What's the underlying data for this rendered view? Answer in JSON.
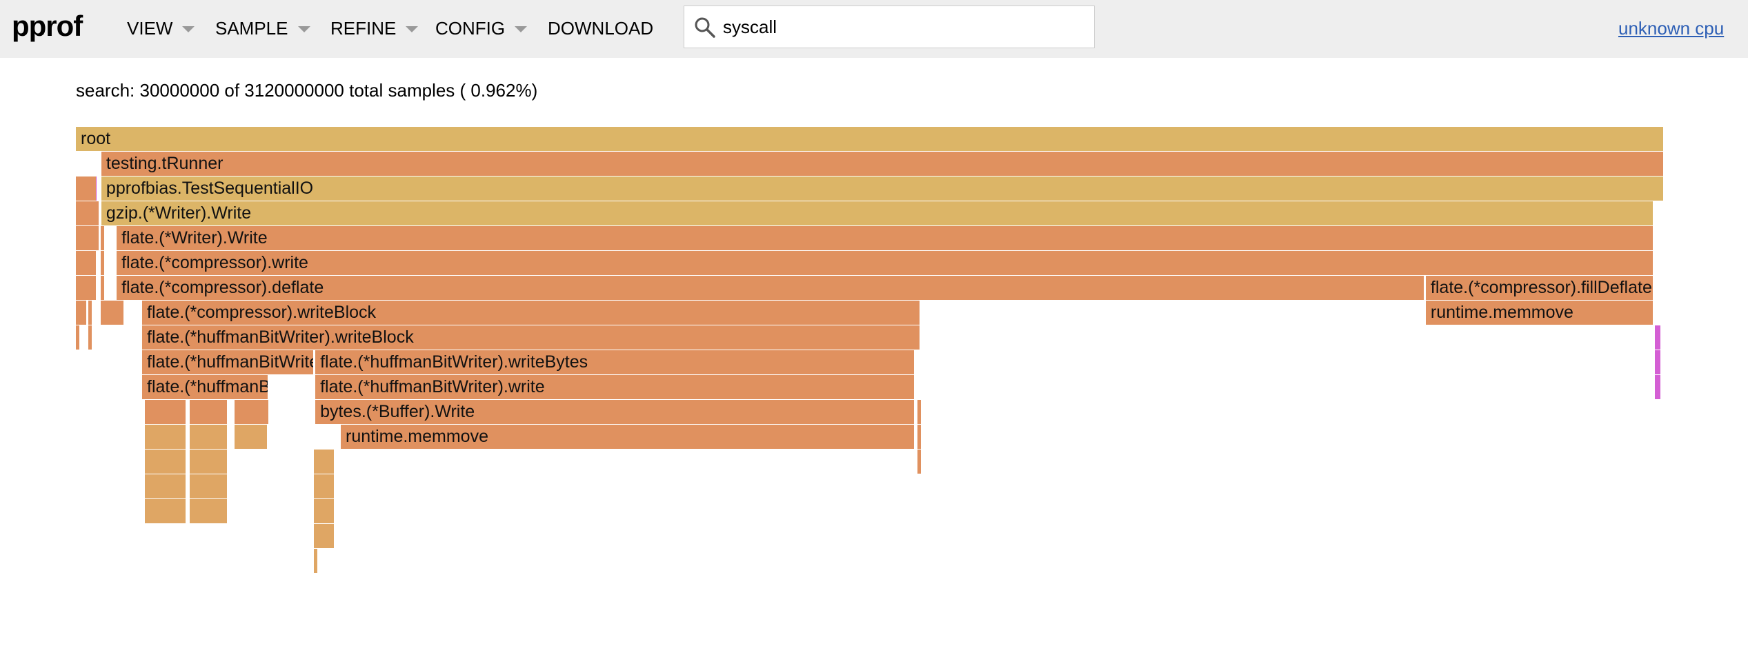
{
  "header": {
    "logo": "pprof",
    "menus": [
      "VIEW",
      "SAMPLE",
      "REFINE",
      "CONFIG",
      "DOWNLOAD"
    ],
    "search_value": "syscall",
    "cpu_link": "unknown cpu"
  },
  "summary_text": "search: 30000000 of 3120000000 total samples ( 0.962%)",
  "colors": {
    "header_bg": "#eeeeee",
    "frame_gold": "#dcb567",
    "frame_orange": "#e0915f",
    "frame_tan": "#dfa664",
    "search_match": "#d45fd4",
    "link": "#2d5fb5"
  },
  "flame_graph": {
    "frames": [
      {
        "name": "root",
        "depth": 0,
        "start": 0,
        "end": 3120000000,
        "color": "gold"
      },
      {
        "name": "testing.tRunner",
        "depth": 1,
        "start": 50000000,
        "end": 3120000000,
        "color": "orange"
      },
      {
        "name": "pprofbias.TestSequentialIO",
        "depth": 2,
        "start": 50000000,
        "end": 3120000000,
        "color": "gold"
      },
      {
        "name": "gzip.(*Writer).Write",
        "depth": 3,
        "start": 50000000,
        "end": 3100000000,
        "color": "gold"
      },
      {
        "name": "flate.(*Writer).Write",
        "depth": 4,
        "start": 80000000,
        "end": 3100000000,
        "color": "orange"
      },
      {
        "name": "flate.(*compressor).write",
        "depth": 5,
        "start": 80000000,
        "end": 3100000000,
        "color": "orange"
      },
      {
        "name": "flate.(*compressor).deflate",
        "depth": 6,
        "start": 80000000,
        "end": 2650000000,
        "color": "orange"
      },
      {
        "name": "flate.(*compressor).fillDeflate",
        "depth": 6,
        "start": 2650000000,
        "end": 3100000000,
        "color": "orange"
      },
      {
        "name": "flate.(*compressor).writeBlock",
        "depth": 7,
        "start": 130000000,
        "end": 1660000000,
        "color": "orange"
      },
      {
        "name": "runtime.memmove",
        "depth": 7,
        "start": 2650000000,
        "end": 3100000000,
        "color": "orange"
      },
      {
        "name": "flate.(*huffmanBitWriter).writeBlock",
        "depth": 8,
        "start": 130000000,
        "end": 1660000000,
        "color": "orange"
      },
      {
        "name": "flate.(*huffmanBitWriter).writeTokens",
        "depth": 9,
        "start": 130000000,
        "end": 470000000,
        "color": "orange"
      },
      {
        "name": "flate.(*huffmanBitWriter).writeBytes",
        "depth": 9,
        "start": 470000000,
        "end": 1650000000,
        "color": "orange"
      },
      {
        "name": "flate.(*huffmanBitWriter).writeCode",
        "depth": 10,
        "start": 130000000,
        "end": 380000000,
        "color": "orange"
      },
      {
        "name": "flate.(*huffmanBitWriter).write",
        "depth": 10,
        "start": 470000000,
        "end": 1650000000,
        "color": "orange"
      },
      {
        "name": "bytes.(*Buffer).Write",
        "depth": 11,
        "start": 470000000,
        "end": 1650000000,
        "color": "orange"
      },
      {
        "name": "runtime.memmove",
        "depth": 12,
        "start": 520000000,
        "end": 1650000000,
        "color": "orange"
      }
    ],
    "search_matches": [
      {
        "depth": 2,
        "start": 30000000,
        "end": 40000000
      },
      {
        "depth": 8,
        "start": 3100000000,
        "end": 3110000000
      },
      {
        "depth": 9,
        "start": 3100000000,
        "end": 3110000000
      },
      {
        "depth": 10,
        "start": 3100000000,
        "end": 3110000000
      }
    ]
  }
}
